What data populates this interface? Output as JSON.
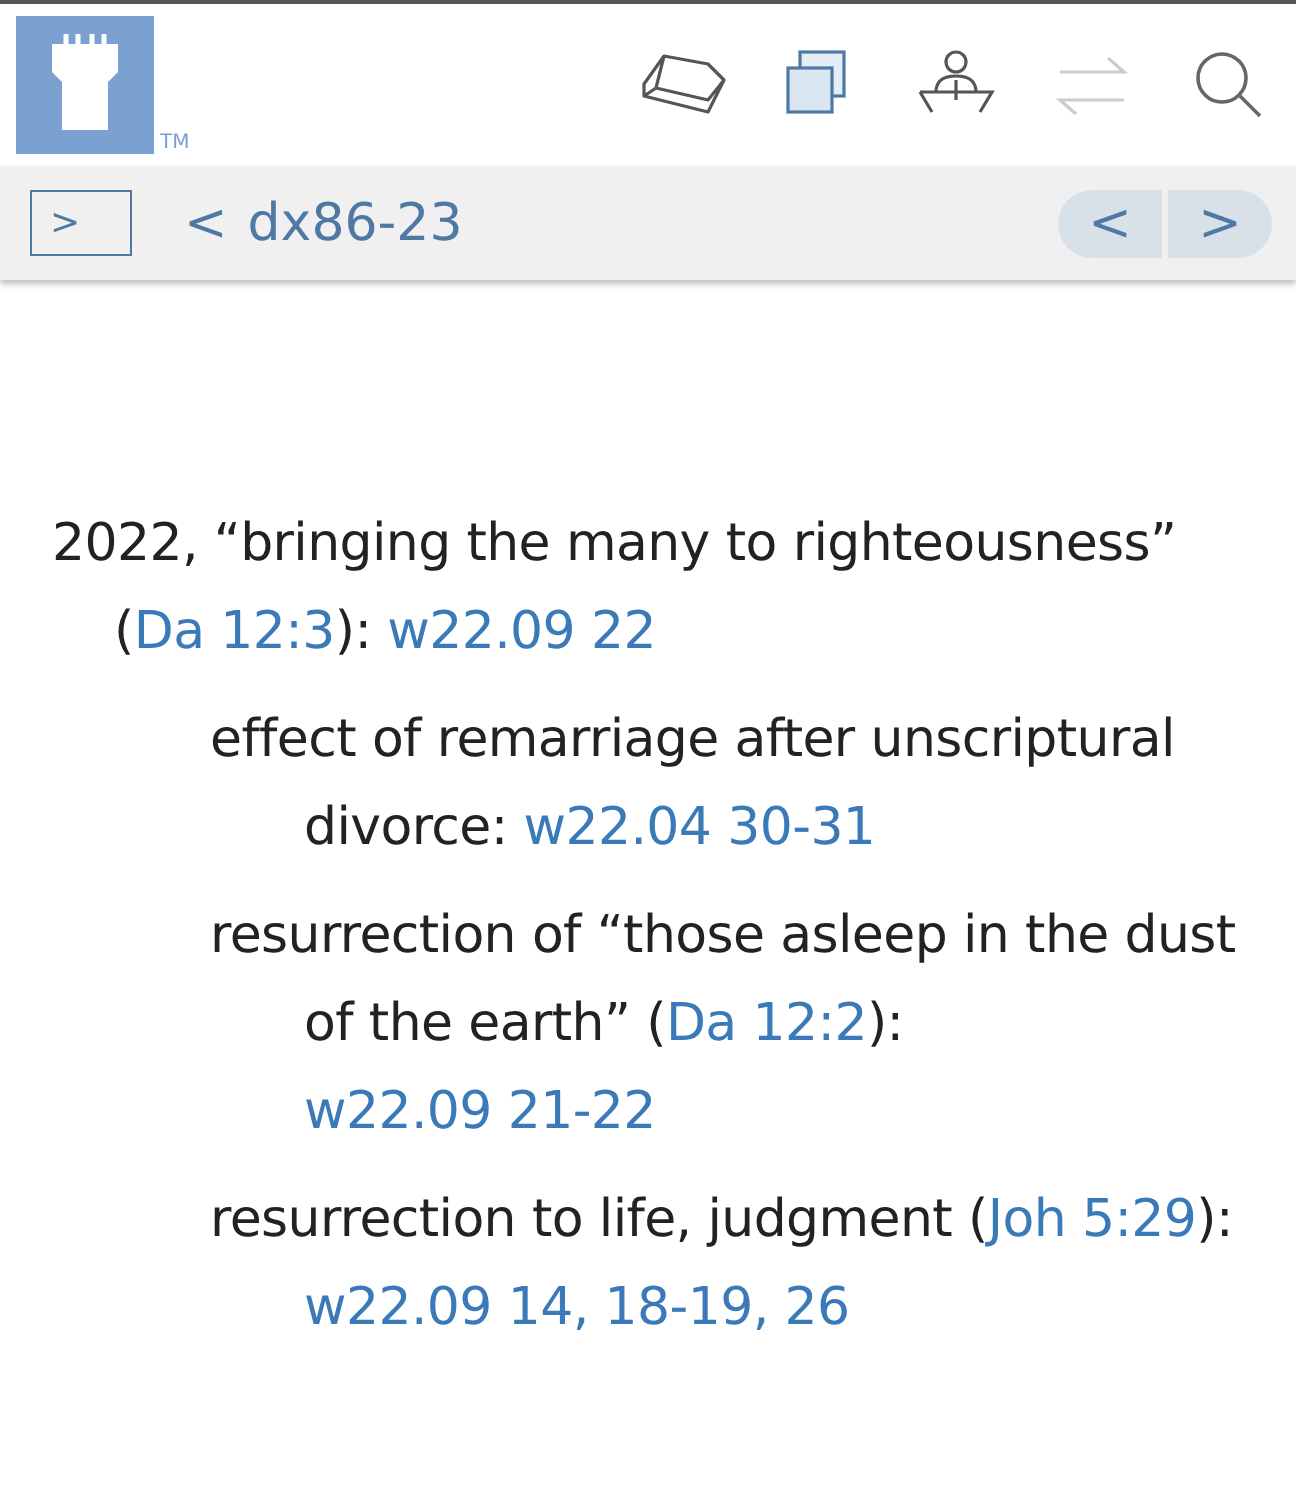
{
  "header": {
    "logo": {
      "trademark": "TM"
    },
    "toolbar": [
      {
        "kind": "book",
        "disabled": false
      },
      {
        "kind": "copy",
        "disabled": false
      },
      {
        "kind": "speaker",
        "disabled": false
      },
      {
        "kind": "swap",
        "disabled": true
      },
      {
        "kind": "search",
        "disabled": false
      }
    ]
  },
  "nav": {
    "sidebar_toggle": ">",
    "back_chevron": "<",
    "title": "dx86-23",
    "prev": "<",
    "next": ">"
  },
  "entries": [
    {
      "parts": [
        {
          "kind": "text",
          "text": "2022, “bringing the many to righteousness” ("
        },
        {
          "kind": "link",
          "text": "Da 12:3"
        },
        {
          "kind": "text",
          "text": "): "
        },
        {
          "kind": "link",
          "text": "w22.09 22"
        }
      ],
      "children": [
        {
          "parts": [
            {
              "kind": "text",
              "text": "effect of remarriage after unscriptural divorce: "
            },
            {
              "kind": "link",
              "text": "w22.04 30-31"
            }
          ]
        },
        {
          "parts": [
            {
              "kind": "text",
              "text": "resurrection of “those asleep in the dust of the earth” ("
            },
            {
              "kind": "link",
              "text": "Da 12:2"
            },
            {
              "kind": "text",
              "text": "): "
            },
            {
              "kind": "link",
              "text": "w22.09 21-22"
            }
          ]
        },
        {
          "parts": [
            {
              "kind": "text",
              "text": "resurrection to life, judgment ("
            },
            {
              "kind": "link",
              "text": "Joh 5:29"
            },
            {
              "kind": "text",
              "text": "): "
            },
            {
              "kind": "link",
              "text": "w22.09 14, 18-19, 26"
            }
          ]
        }
      ]
    }
  ]
}
